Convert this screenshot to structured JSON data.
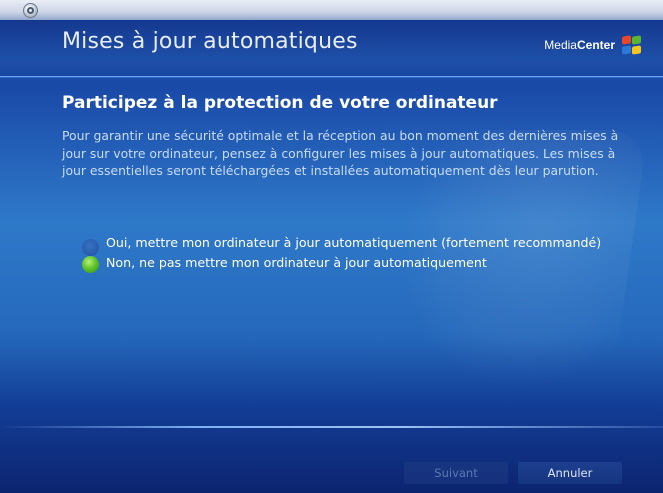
{
  "window": {
    "title": "Mises à jour automatiques",
    "brand": {
      "text_normal": "Media",
      "text_bold": "Center"
    }
  },
  "main": {
    "heading": "Participez à la protection de votre ordinateur",
    "description": "Pour garantir une sécurité optimale et la réception au bon moment des dernières mises à jour sur votre ordinateur, pensez à configurer les mises à jour automatiques. Les mises à jour essentielles seront téléchargées et installées automatiquement dès leur parution.",
    "options": [
      {
        "label": "Oui, mettre mon ordinateur à jour automatiquement (fortement recommandé)",
        "selected": false
      },
      {
        "label": "Non, ne pas mettre mon ordinateur à jour automatiquement",
        "selected": true
      }
    ]
  },
  "footer": {
    "next_label": "Suivant",
    "next_enabled": false,
    "cancel_label": "Annuler"
  },
  "icons": {
    "start_orb": "media-center-orb-icon",
    "brand_logo": "windows-flag-icon",
    "radio_selected": "radio-selected-icon",
    "radio_unselected": "radio-unselected-icon"
  },
  "colors": {
    "background_top": "#1a49a6",
    "background_mid": "#2f79c9",
    "background_bottom": "#0c246f",
    "title_text": "#e8eef8",
    "body_text": "#c9dcf5",
    "radio_selected": "#62c42a",
    "button_disabled_text": "#5b78b3"
  }
}
